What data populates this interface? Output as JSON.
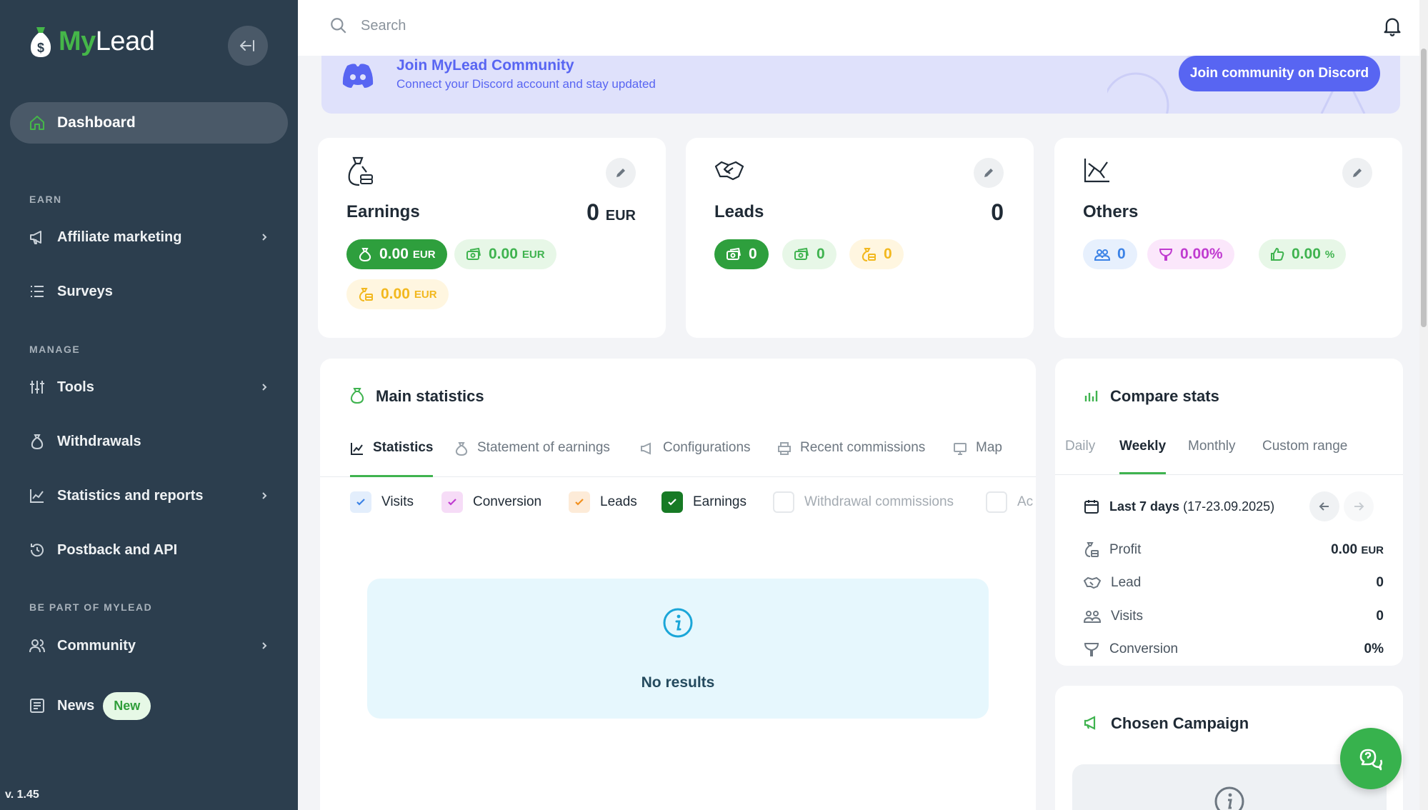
{
  "app": {
    "logo_my": "My",
    "logo_lead": "Lead",
    "version": "v. 1.45"
  },
  "sidebar": {
    "dashboard": "Dashboard",
    "sections": {
      "earn": "EARN",
      "manage": "MANAGE",
      "be_part": "BE PART OF MYLEAD"
    },
    "items": {
      "affiliate": "Affiliate marketing",
      "surveys": "Surveys",
      "tools": "Tools",
      "withdrawals": "Withdrawals",
      "statistics": "Statistics and reports",
      "postback": "Postback and API",
      "community": "Community",
      "news": "News",
      "news_badge": "New"
    }
  },
  "search": {
    "placeholder": "Search"
  },
  "discord": {
    "title": "Join MyLead Community",
    "subtitle": "Connect your Discord account and stay updated",
    "button": "Join community on Discord"
  },
  "cards": {
    "earnings": {
      "title": "Earnings",
      "value": "0",
      "unit": "EUR",
      "pills": [
        {
          "v": "0.00",
          "u": "EUR"
        },
        {
          "v": "0.00",
          "u": "EUR"
        },
        {
          "v": "0.00",
          "u": "EUR"
        }
      ]
    },
    "leads": {
      "title": "Leads",
      "value": "0",
      "pills": [
        "0",
        "0",
        "0"
      ]
    },
    "others": {
      "title": "Others",
      "pills": [
        {
          "v": "0",
          "u": ""
        },
        {
          "v": "0.00",
          "u": "%"
        },
        {
          "v": "0.00",
          "u": "%"
        }
      ]
    }
  },
  "main_stats": {
    "title": "Main statistics",
    "tabs": [
      "Statistics",
      "Statement of earnings",
      "Configurations",
      "Recent commissions",
      "Map"
    ],
    "checks": [
      "Visits",
      "Conversion",
      "Leads",
      "Earnings",
      "Withdrawal commissions",
      "Ac"
    ],
    "no_results": "No results"
  },
  "compare": {
    "title": "Compare stats",
    "tabs": [
      "Daily",
      "Weekly",
      "Monthly",
      "Custom range"
    ],
    "range_label": "Last 7 days",
    "range_dates": "(17-23.09.2025)",
    "rows": [
      {
        "label": "Profit",
        "value": "0.00",
        "unit": "EUR"
      },
      {
        "label": "Lead",
        "value": "0",
        "unit": ""
      },
      {
        "label": "Visits",
        "value": "0",
        "unit": ""
      },
      {
        "label": "Conversion",
        "value": "0%",
        "unit": ""
      }
    ]
  },
  "chosen": {
    "title": "Chosen Campaign"
  },
  "colors": {
    "sidebar": "#2c3e4e",
    "accent": "#3fb34f",
    "discord": "#5865f2"
  }
}
